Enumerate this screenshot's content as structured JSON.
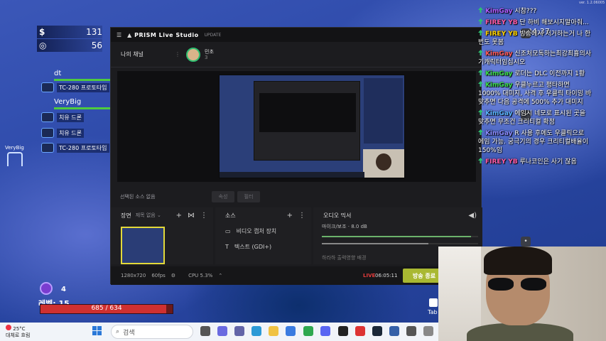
{
  "game": {
    "resource1": {
      "icon": "$",
      "value": "131"
    },
    "resource2": {
      "icon": "◎",
      "value": "56"
    },
    "team": [
      {
        "name": "dt",
        "health": 1.0
      },
      {
        "name": "VeryBig",
        "health": 1.0
      }
    ],
    "mechs": [
      {
        "label": "TC-280 프로토타입"
      },
      {
        "label": "치유 드론"
      },
      {
        "label": "치유 드론"
      },
      {
        "label": "TC-280 프로토타입"
      }
    ],
    "map_label": "VeryBig",
    "level_label": "레벨: 15",
    "hp_text": "685 / 634",
    "hp_fraction": 0.95,
    "counter": "4",
    "tab_label": "Tab",
    "version": "ver. 1.2.06005"
  },
  "taskbar": {
    "weather_temp": "25°C",
    "weather_desc": "대체로 흐림",
    "search_placeholder": "검색"
  },
  "prism": {
    "title": "PRISM Live Studio",
    "update": "UPDATE",
    "channel_title": "나의 채널",
    "channel_user": "민초",
    "channel_count": "3",
    "selected_source": "선택된 소스 없음",
    "btn_edit": "속성",
    "btn_filter": "필터",
    "scene_header": "장면",
    "scene_sub": "제목 없음",
    "source_header": "소스",
    "sources": [
      "비디오 캡처 장치",
      "텍스트 (GDI+)"
    ],
    "mixer_header": "오디오 믹서",
    "mixer_row": "마이크/보조 · 8.0 dB",
    "mixer_row2": "하라하 출력영향 배경",
    "resolution": "1280x720",
    "fps": "60fps",
    "cpu": "CPU 5.3%",
    "live": "LIVE",
    "live_time": "06:05:11",
    "end_button": "방송 종료"
  },
  "chat": {
    "clock": "24:37",
    "messages": [
      {
        "user": "KimGay",
        "user_color": "#b05cff",
        "text": "시참???"
      },
      {
        "user": "FIREY YB",
        "user_color": "#ff5ca8",
        "text": "단 하비 해보시지말아줘..."
      },
      {
        "user": "FIREY YB",
        "user_color": "#ffd200",
        "text": "방송에서 저거하는거 나 한번도 못봄"
      },
      {
        "user": "KimGay",
        "user_color": "#ff5a5a",
        "text": "신조처모독하는최강최흉의사기캐릭터임십시오"
      },
      {
        "user": "KimGay",
        "user_color": "#3ddc4d",
        "text": "로더는 DLC 이전까지 1황"
      },
      {
        "user": "KimGay",
        "user_color": "#3ddc4d",
        "text": "우클누르고 평타하면 1000% 대미지, 사격 후 우클릭 타이밍 바 맞추면 다음 공격에 500% 추가 대미지"
      },
      {
        "user": "KimGay",
        "user_color": "#5ab4ff",
        "text": "에임시 네모로 표시된 곳을 맞추면 무조건 크리티컬 확정"
      },
      {
        "user": "KimGay",
        "user_color": "#8a8aff",
        "text": "R 사용 후에도 우클릭으로 에임 가능. 궁극기의 경우 크리티컬배율이 150%임"
      },
      {
        "user": "FIREY YB",
        "user_color": "#ff5ca8",
        "text": "루나코인은 사기 잖음"
      }
    ]
  }
}
